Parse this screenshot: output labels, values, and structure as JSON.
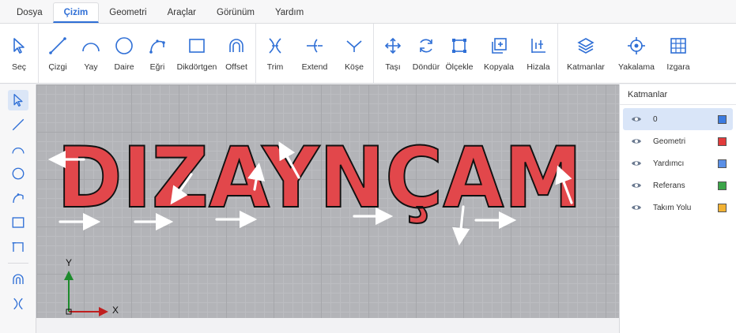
{
  "menu": [
    "Dosya",
    "Çizim",
    "Geometri",
    "Araçlar",
    "Görünüm",
    "Yardım"
  ],
  "ribbon": {
    "select": "Seç",
    "draw": [
      "Çizgi",
      "Yay",
      "Daire",
      "Eğri",
      "Dikdörtgen",
      "Offset"
    ],
    "modify": [
      "Trim",
      "Extend",
      "Köşe"
    ],
    "transform": [
      "Taşı",
      "Döndür",
      "Ölçekle",
      "Kopyala",
      "Hizala"
    ],
    "settings": [
      "Katmanlar",
      "Yakalama",
      "Izgara"
    ]
  },
  "canvas": {
    "text": "DIZAYNÇAM",
    "axis_y": "Y",
    "axis_x": "X"
  },
  "layers": {
    "title": "Katmanlar",
    "items": [
      {
        "name": "0",
        "color": "#3b7be0"
      },
      {
        "name": "Geometri",
        "color": "#e23b3b"
      },
      {
        "name": "Yardımcı",
        "color": "#5a8fe6"
      },
      {
        "name": "Referans",
        "color": "#3ba548"
      },
      {
        "name": "Takım Yolu",
        "color": "#f2b233"
      }
    ]
  }
}
